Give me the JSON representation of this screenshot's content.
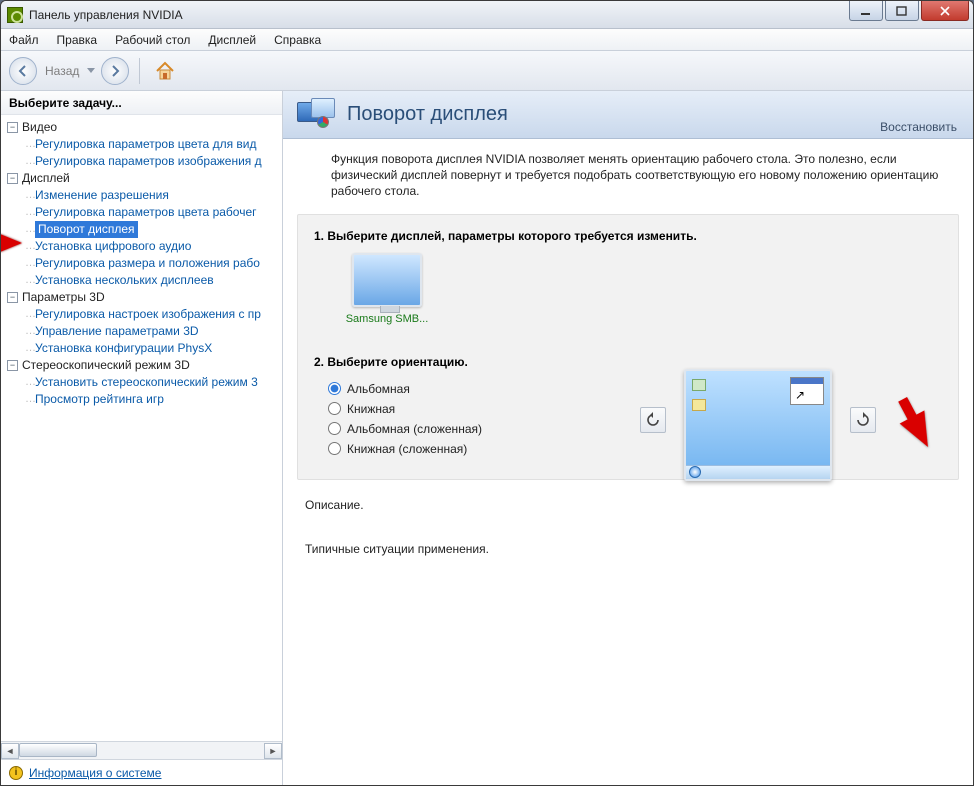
{
  "window": {
    "title": "Панель управления NVIDIA"
  },
  "menu": {
    "file": "Файл",
    "edit": "Правка",
    "desktop": "Рабочий стол",
    "display": "Дисплей",
    "help": "Справка"
  },
  "toolbar": {
    "back": "Назад"
  },
  "sidebar": {
    "heading": "Выберите задачу...",
    "video": {
      "label": "Видео",
      "items": [
        "Регулировка параметров цвета для вид",
        "Регулировка параметров изображения д"
      ]
    },
    "display": {
      "label": "Дисплей",
      "items": [
        "Изменение разрешения",
        "Регулировка параметров цвета рабочег",
        "Поворот дисплея",
        "Установка цифрового аудио",
        "Регулировка размера и положения рабо",
        "Установка нескольких дисплеев"
      ]
    },
    "params3d": {
      "label": "Параметры 3D",
      "items": [
        "Регулировка настроек изображения с пр",
        "Управление параметрами 3D",
        "Установка конфигурации PhysX"
      ]
    },
    "stereo": {
      "label": "Стереоскопический режим 3D",
      "items": [
        "Установить стереоскопический режим 3",
        "Просмотр рейтинга игр"
      ]
    },
    "sysinfo": "Информация о системе"
  },
  "content": {
    "title": "Поворот дисплея",
    "restore": "Восстановить",
    "description": "Функция поворота дисплея NVIDIA позволяет менять ориентацию рабочего стола. Это полезно, если физический дисплей повернут и требуется подобрать соответствующую его новому положению ориентацию рабочего стола.",
    "step1": "1. Выберите дисплей, параметры которого требуется изменить.",
    "monitor_label": "Samsung SMB...",
    "step2": "2. Выберите ориентацию.",
    "orientations": [
      "Альбомная",
      "Книжная",
      "Альбомная (сложенная)",
      "Книжная (сложенная)"
    ],
    "descr_head": "Описание.",
    "typical_head": "Типичные ситуации применения."
  }
}
